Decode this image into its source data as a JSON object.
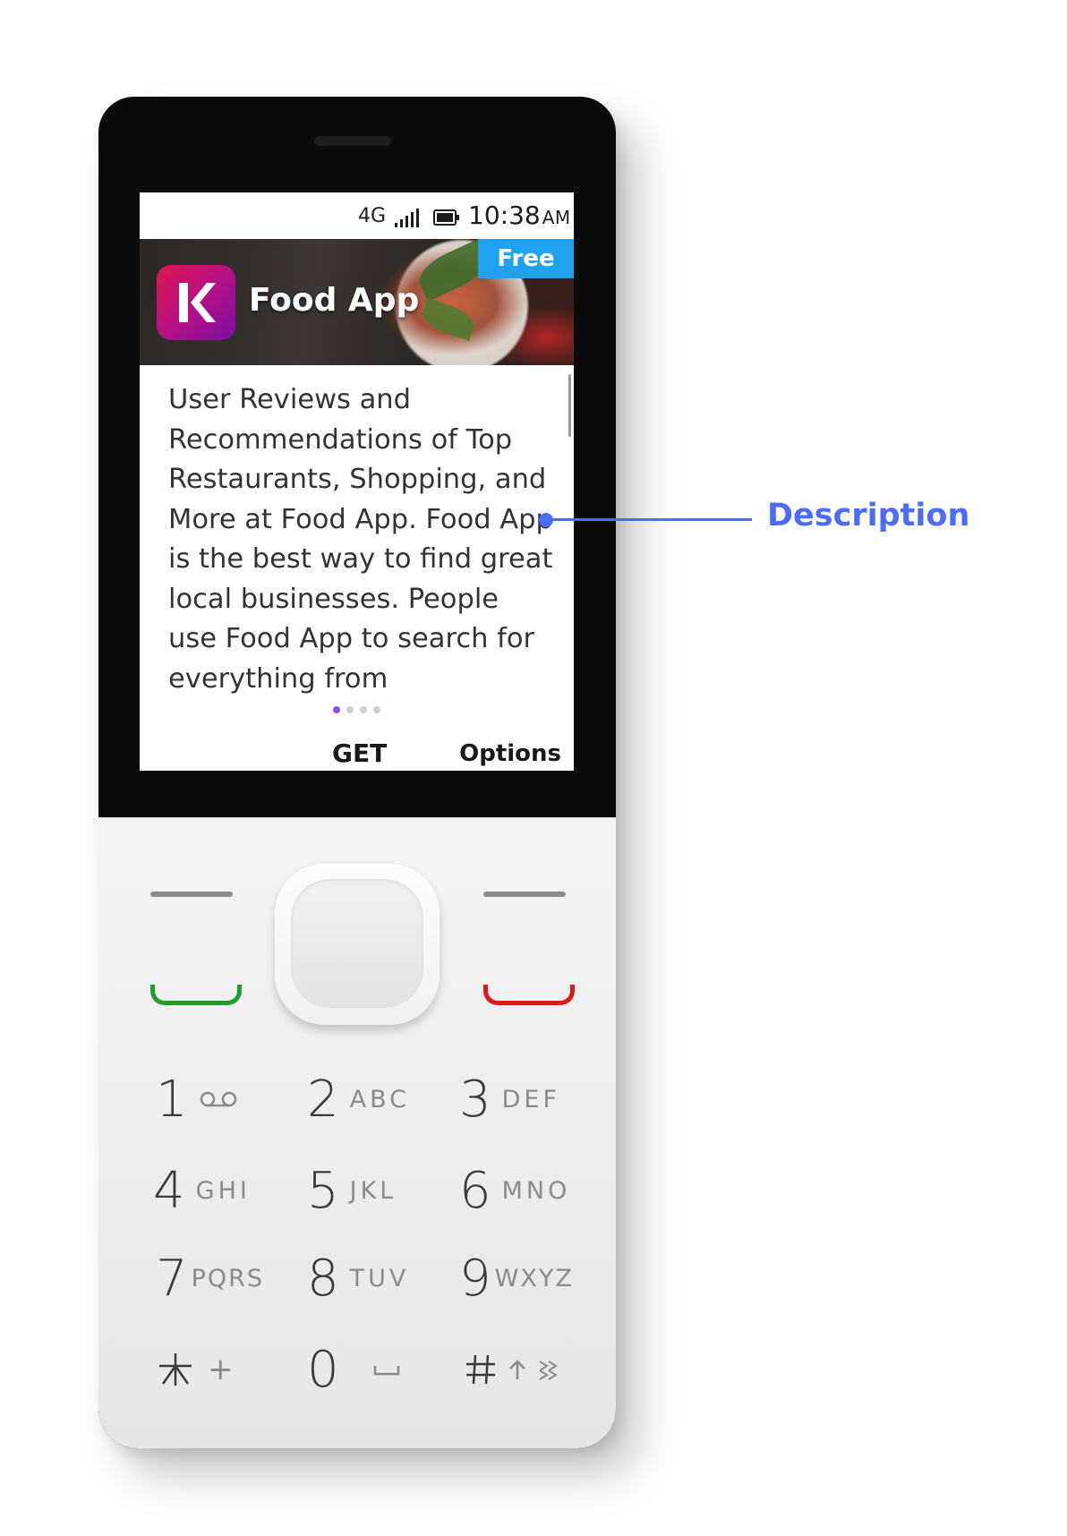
{
  "status_bar": {
    "network": "4G",
    "time": "10:38",
    "ampm": "AM"
  },
  "app": {
    "name": "Food App",
    "price_badge": "Free",
    "description": "User Reviews and Recommendations of Top Restaurants, Shopping, and More at Food App. Food App is the best way to find great local businesses. People use Food App to search for everything from",
    "page_count": 4,
    "active_page": 1
  },
  "softkeys": {
    "left": "",
    "center": "GET",
    "right": "Options"
  },
  "keypad": {
    "keys": [
      {
        "num": "1",
        "sub": ""
      },
      {
        "num": "2",
        "sub": "ABC"
      },
      {
        "num": "3",
        "sub": "DEF"
      },
      {
        "num": "4",
        "sub": "GHI"
      },
      {
        "num": "5",
        "sub": "JKL"
      },
      {
        "num": "6",
        "sub": "MNO"
      },
      {
        "num": "7",
        "sub": "PQRS"
      },
      {
        "num": "8",
        "sub": "TUV"
      },
      {
        "num": "9",
        "sub": "WXYZ"
      },
      {
        "num": "",
        "sub": "+"
      },
      {
        "num": "0",
        "sub": ""
      },
      {
        "num": "#",
        "sub": ""
      }
    ],
    "icons": {
      "key1": "voicemail-icon",
      "key0": "space-icon",
      "key_star": "asterisk-icon",
      "key_hash": "shift-icon"
    }
  },
  "annotation": {
    "label": "Description"
  },
  "colors": {
    "badge": "#1fa2f0",
    "annotation": "#4a6cf7",
    "call_key": "#1e9e2a",
    "end_key": "#e01818",
    "active_dot": "#8a4ff0"
  }
}
